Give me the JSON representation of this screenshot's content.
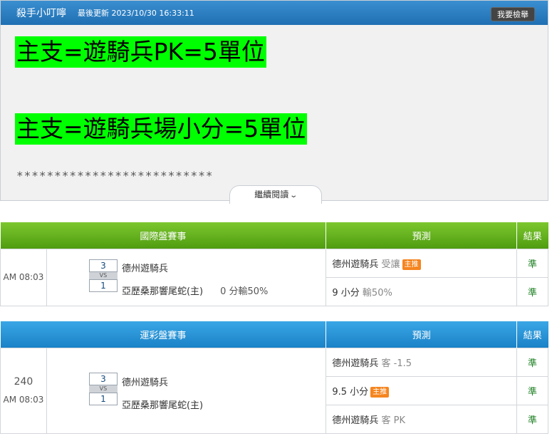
{
  "header": {
    "title": "殺手小叮嚀",
    "updated": "最後更新 2023/10/30 16:33:11",
    "report_button": "我要檢舉"
  },
  "content": {
    "highlight_1": "主支=遊騎兵PK=5單位",
    "highlight_2": "主支=遊騎兵場小分=5單位",
    "stars": "**************************",
    "read_more": "繼續閱讀"
  },
  "international": {
    "headers": [
      "國際盤賽事",
      "預測",
      "結果"
    ],
    "time": "AM 08:03",
    "score_home": "3",
    "vs": "VS",
    "score_away": "1",
    "team_home": "德州遊騎兵",
    "team_away": "亞歷桑那響尾蛇(主)",
    "handicap": "0 分輸50%",
    "predictions": [
      {
        "main": "德州遊騎兵",
        "sub": "受讓",
        "badge": "主推",
        "result": "準"
      },
      {
        "main": "9 小分",
        "sub": "輸50%",
        "badge": "",
        "result": "準"
      }
    ]
  },
  "lottery": {
    "headers": [
      "運彩盤賽事",
      "預測",
      "結果"
    ],
    "number": "240",
    "time": "AM 08:03",
    "score_home": "3",
    "vs": "VS",
    "score_away": "1",
    "team_home": "德州遊騎兵",
    "team_away": "亞歷桑那響尾蛇(主)",
    "predictions": [
      {
        "main": "德州遊騎兵",
        "sub": "客 -1.5",
        "badge": "",
        "result": "準"
      },
      {
        "main": "9.5 小分",
        "sub": "",
        "badge": "主推",
        "result": "準"
      },
      {
        "main": "德州遊騎兵",
        "sub": "客 PK",
        "badge": "",
        "result": "準"
      }
    ]
  },
  "colors": {
    "highlight": "#00ff00",
    "titlebar": "#1f6fb3",
    "international_header": "#5fae1c",
    "lottery_header": "#2596d9",
    "badge": "#f5851f",
    "result": "#1c7f22"
  }
}
